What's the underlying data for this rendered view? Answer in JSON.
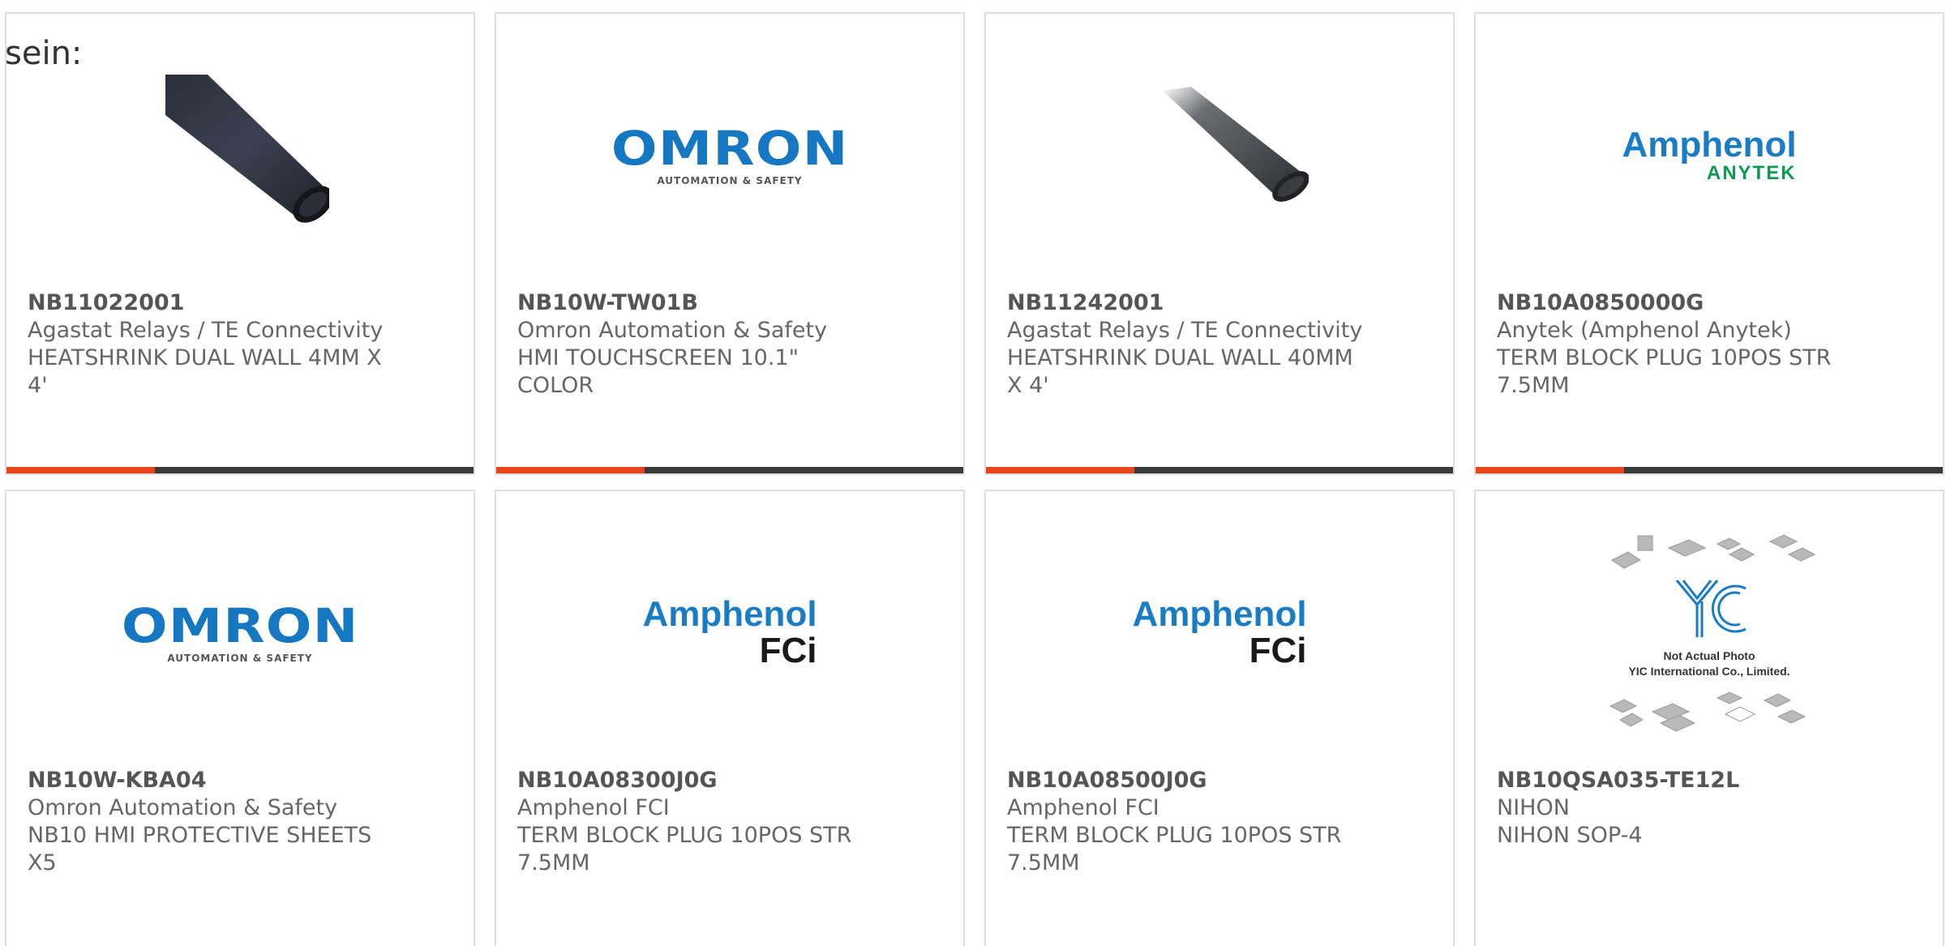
{
  "fragment_text": "sein:",
  "colors": {
    "accent": "#e8461a",
    "bar": "#3a3a3a",
    "omron_blue": "#1577c2",
    "amphenol_blue": "#1a7cc4",
    "anytek_green": "#0b9a52"
  },
  "products": [
    {
      "part_number": "NB11022001",
      "manufacturer": "Agastat Relays / TE Connectivity",
      "description": "HEATSHRINK DUAL WALL 4MM X 4'",
      "image": "heatshrink-tube-photo"
    },
    {
      "part_number": "NB10W-TW01B",
      "manufacturer": "Omron Automation & Safety",
      "description": "HMI TOUCHSCREEN 10.1\" COLOR",
      "image": "omron-logo",
      "logo": {
        "main": "OMRON",
        "sub": "AUTOMATION & SAFETY"
      }
    },
    {
      "part_number": "NB11242001",
      "manufacturer": "Agastat Relays / TE Connectivity",
      "description": "HEATSHRINK DUAL WALL 40MM X 4'",
      "image": "heatshrink-tube-photo"
    },
    {
      "part_number": "NB10A0850000G",
      "manufacturer": "Anytek (Amphenol Anytek)",
      "description": "TERM BLOCK PLUG 10POS STR 7.5MM",
      "image": "amphenol-anytek-logo",
      "logo": {
        "main": "Amphenol",
        "sub": "ANYTEK"
      }
    },
    {
      "part_number": "NB10W-KBA04",
      "manufacturer": "Omron Automation & Safety",
      "description": "NB10 HMI PROTECTIVE SHEETS X5",
      "image": "omron-logo",
      "logo": {
        "main": "OMRON",
        "sub": "AUTOMATION & SAFETY"
      }
    },
    {
      "part_number": "NB10A08300J0G",
      "manufacturer": "Amphenol FCI",
      "description": "TERM BLOCK PLUG 10POS STR 7.5MM",
      "image": "amphenol-fci-logo",
      "logo": {
        "main": "Amphenol",
        "sub": "FCi"
      }
    },
    {
      "part_number": "NB10A08500J0G",
      "manufacturer": "Amphenol FCI",
      "description": "TERM BLOCK PLUG 10POS STR 7.5MM",
      "image": "amphenol-fci-logo",
      "logo": {
        "main": "Amphenol",
        "sub": "FCi"
      }
    },
    {
      "part_number": "NB10QSA035-TE12L",
      "manufacturer": "NIHON",
      "description": "NIHON SOP-4",
      "image": "yic-placeholder-photo",
      "logo": {
        "caption_1": "Not Actual Photo",
        "caption_2": "YIC International Co., Limited."
      }
    }
  ]
}
